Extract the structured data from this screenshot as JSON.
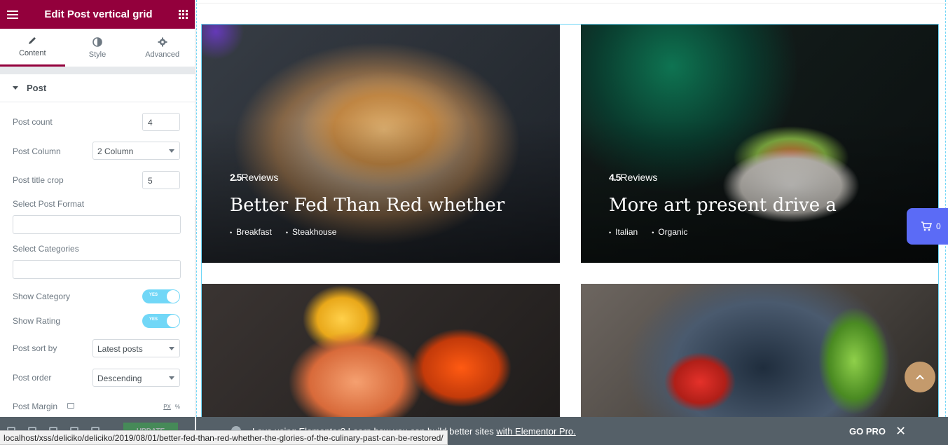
{
  "panel": {
    "title": "Edit Post vertical grid",
    "header_color": "#93003c",
    "tabs": [
      {
        "label": "Content",
        "icon": "pencil-icon"
      },
      {
        "label": "Style",
        "icon": "contrast-icon"
      },
      {
        "label": "Advanced",
        "icon": "gear-icon"
      }
    ],
    "section_title": "Post",
    "controls": {
      "post_count": {
        "label": "Post count",
        "value": "4"
      },
      "post_column": {
        "label": "Post Column",
        "value": "2 Column"
      },
      "post_title_crop": {
        "label": "Post title crop",
        "value": "5"
      },
      "select_post_format": {
        "label": "Select Post Format",
        "value": ""
      },
      "select_categories": {
        "label": "Select Categories",
        "value": ""
      },
      "show_category": {
        "label": "Show Category",
        "state": "YES"
      },
      "show_rating": {
        "label": "Show Rating",
        "state": "YES"
      },
      "post_sort_by": {
        "label": "Post sort by",
        "value": "Latest posts"
      },
      "post_order": {
        "label": "Post order",
        "value": "Descending"
      },
      "post_margin": {
        "label": "Post Margin",
        "unit_px": "PX",
        "unit_pct": "%"
      }
    },
    "footer": {
      "update_label": "UPDATE"
    }
  },
  "posts": [
    {
      "rating": "2.5",
      "rating_label": "Reviews",
      "title": "Better Fed Than Red whether",
      "categories": [
        "Breakfast",
        "Steakhouse"
      ]
    },
    {
      "rating": "4.5",
      "rating_label": "Reviews",
      "title": "More art present drive a",
      "categories": [
        "Italian",
        "Organic"
      ]
    },
    {
      "rating": "",
      "rating_label": "",
      "title": "",
      "categories": []
    },
    {
      "rating": "",
      "rating_label": "",
      "title": "",
      "categories": []
    }
  ],
  "cart": {
    "count": "0",
    "color": "#5b6bf6"
  },
  "notice": {
    "message_prefix": "Love using Elementor? Learn how you can build better sites ",
    "message_link": "with Elementor Pro.",
    "go_pro": "GO PRO",
    "close": "✕"
  },
  "status_url": "localhost/xss/deliciko/deliciko/2019/08/01/better-fed-than-red-whether-the-glories-of-the-culinary-past-can-be-restored/"
}
